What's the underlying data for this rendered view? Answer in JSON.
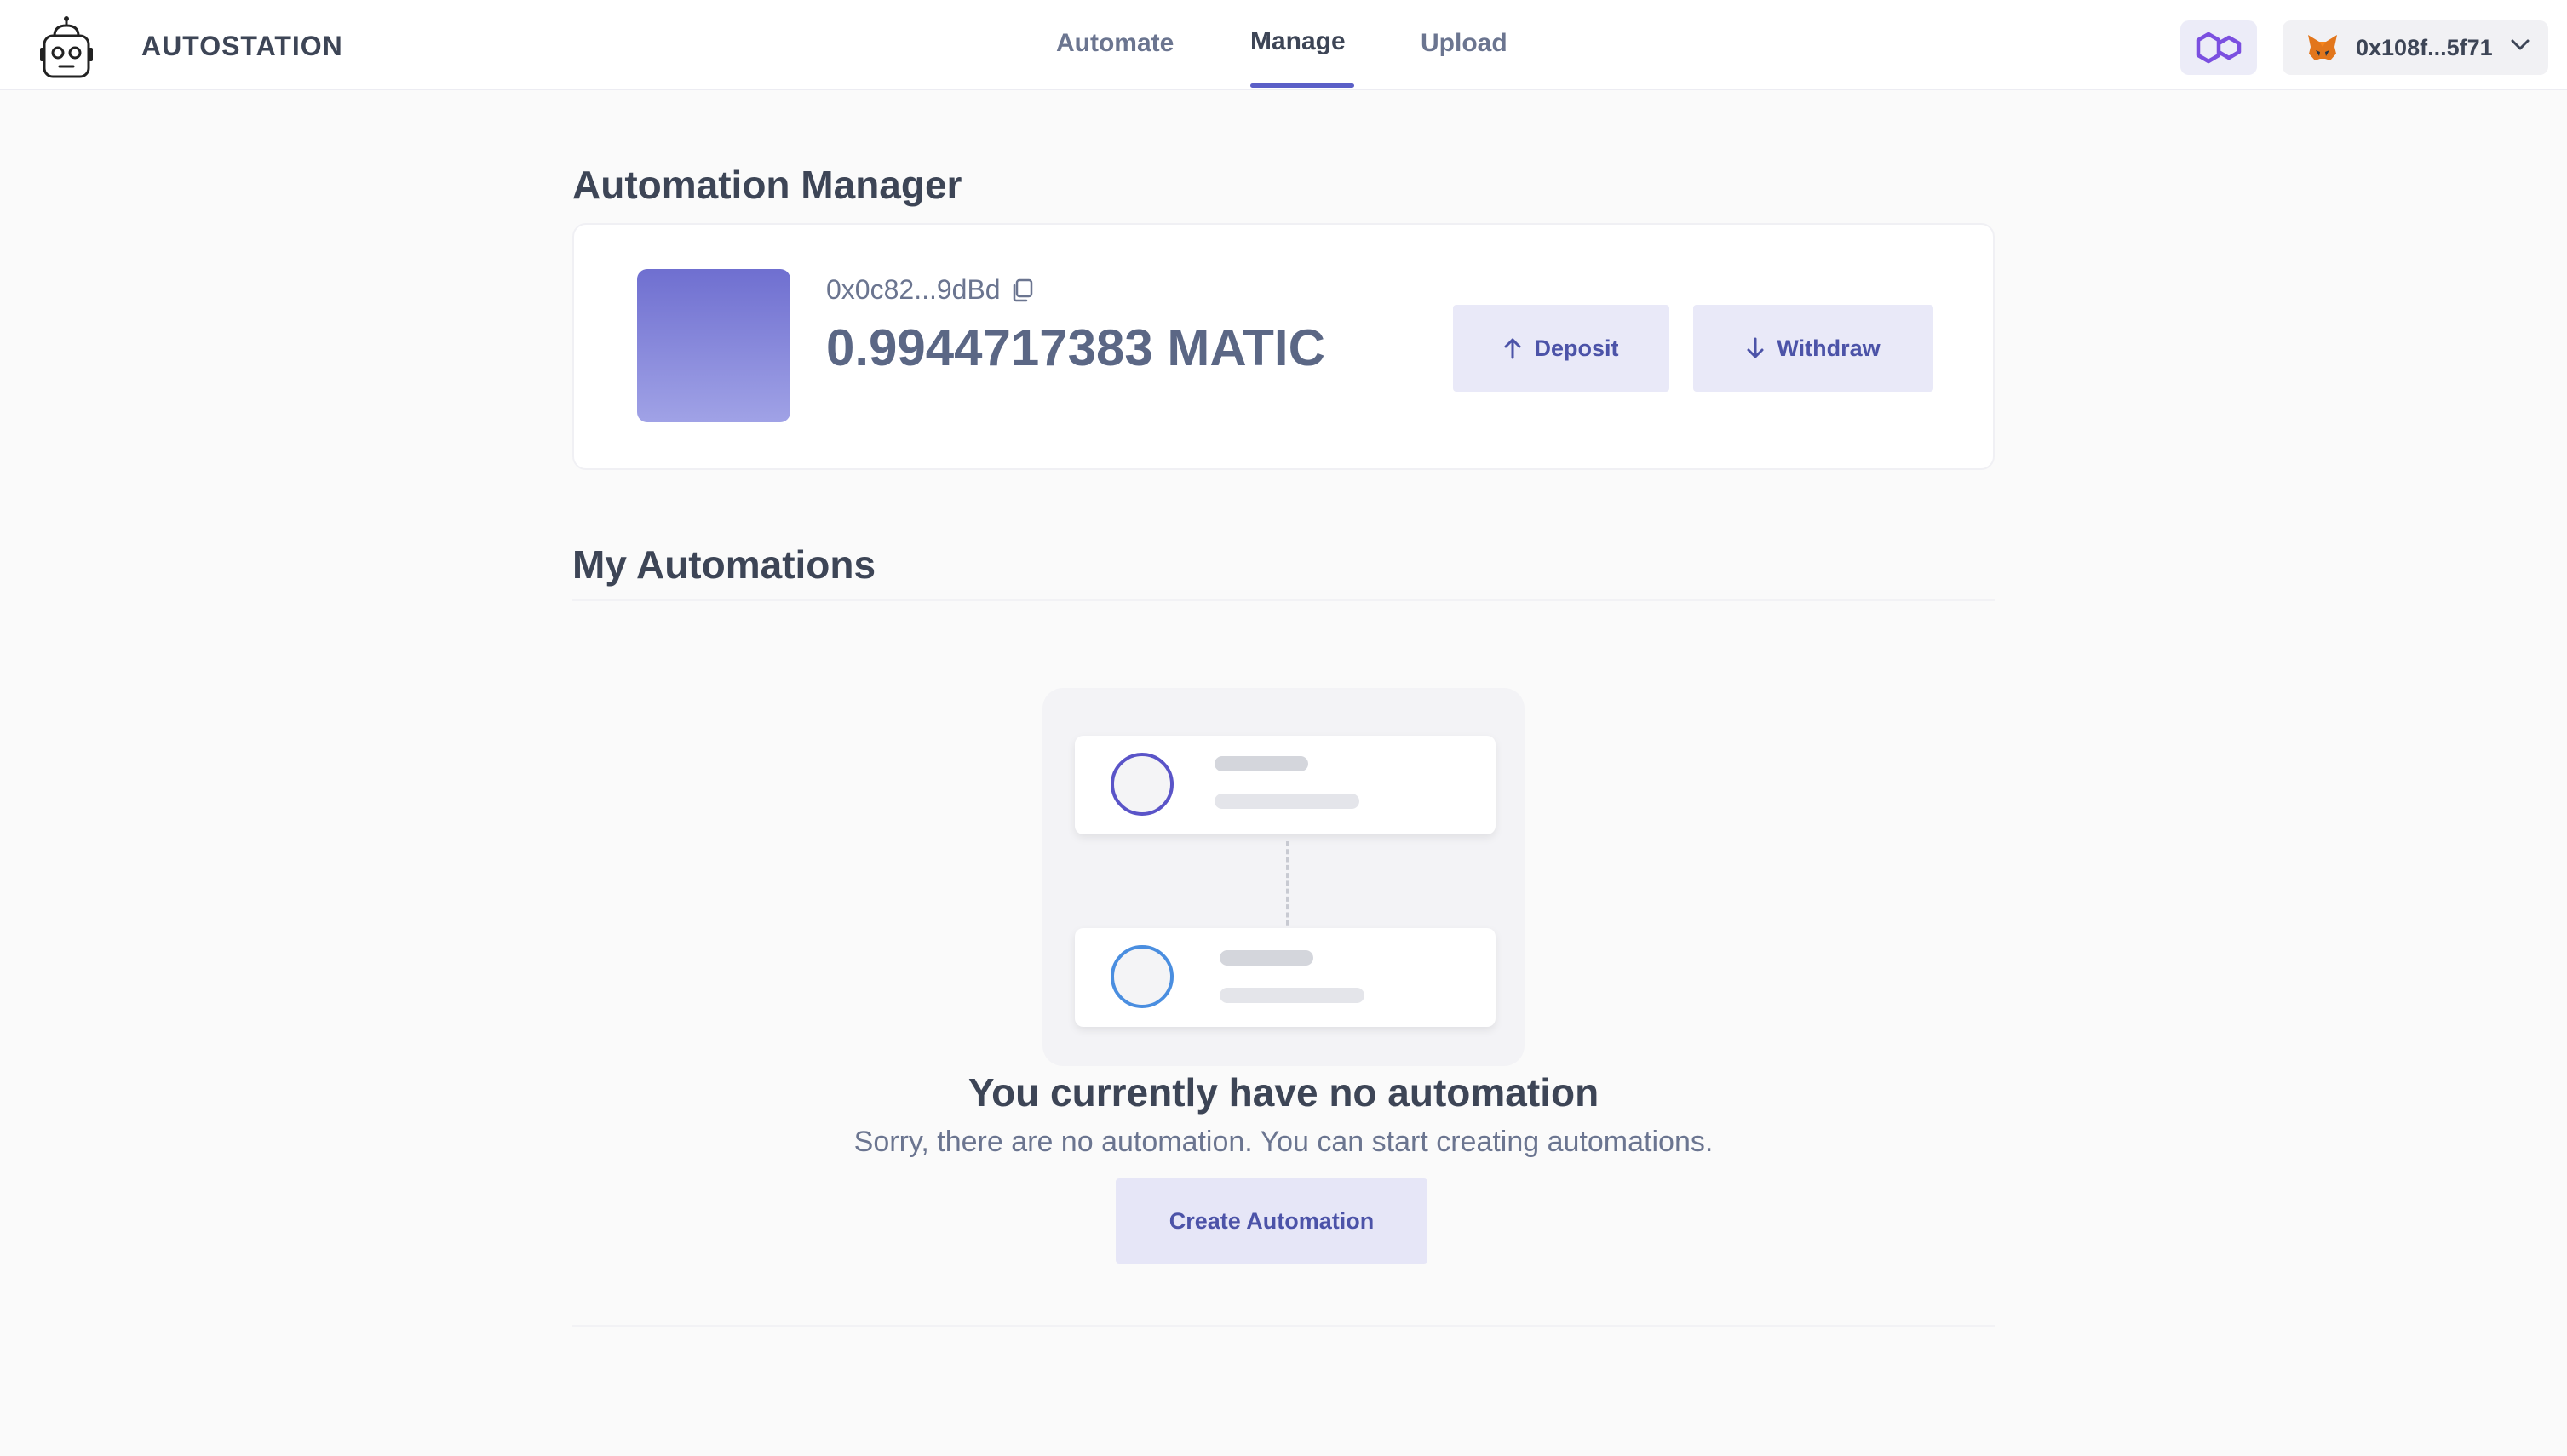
{
  "header": {
    "brand": "AUTOSTATION",
    "tabs": [
      {
        "label": "Automate"
      },
      {
        "label": "Manage",
        "active": true
      },
      {
        "label": "Upload"
      }
    ],
    "network_icon": "polygon-icon",
    "wallet": {
      "icon": "metamask-fox-icon",
      "address": "0x108f...5f71"
    }
  },
  "manager": {
    "title": "Automation Manager",
    "address": "0x0c82...9dBd",
    "balance": "0.9944717383 MATIC",
    "deposit_label": "Deposit",
    "withdraw_label": "Withdraw"
  },
  "automations": {
    "title": "My Automations",
    "empty_title": "You currently have no automation",
    "empty_subtitle": "Sorry, there are no automation. You can start creating automations.",
    "create_label": "Create Automation"
  },
  "colors": {
    "accent": "#5b5fc7",
    "button_bg": "#e9e9f8",
    "button_text": "#4c53a8"
  }
}
